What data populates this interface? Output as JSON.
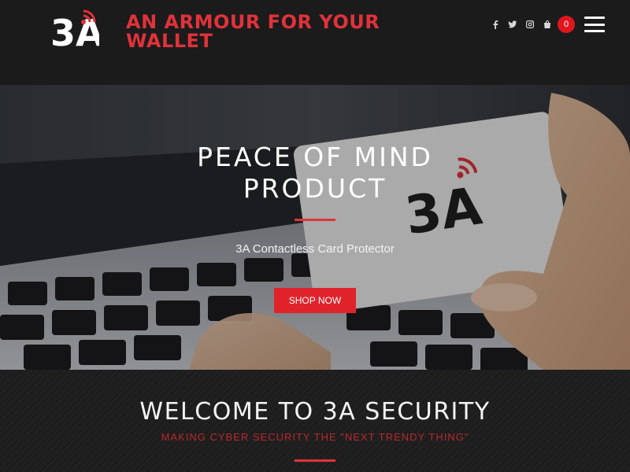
{
  "header": {
    "logo_text": "3A",
    "tagline": "AN ARMOUR FOR YOUR WALLET",
    "social_icons": [
      "facebook-icon",
      "twitter-icon",
      "instagram-icon",
      "shopping-bag-icon"
    ],
    "cart_count": "0",
    "menu_icon": "hamburger-menu-icon"
  },
  "hero": {
    "title": "PEACE OF MIND PRODUCT",
    "card_logo": "3A",
    "subtitle": "3A Contactless Card Protector",
    "button_label": "SHOP NOW"
  },
  "welcome": {
    "title": "WELCOME TO 3A SECURITY",
    "subtitle": "MAKING CYBER SECURITY THE \"NEXT TRENDY THING\""
  },
  "colors": {
    "accent": "#e0323a",
    "header_bg": "#1b1b1b",
    "section_bg": "#1d1d1d"
  }
}
